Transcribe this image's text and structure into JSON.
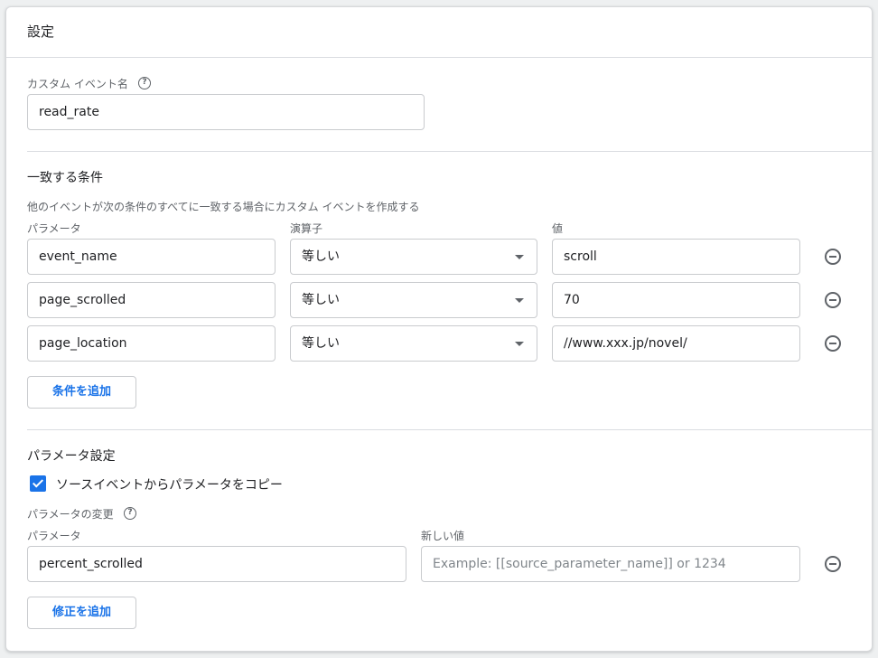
{
  "header": {
    "title": "設定"
  },
  "custom_event": {
    "label": "カスタム イベント名",
    "value": "read_rate"
  },
  "conditions": {
    "title": "一致する条件",
    "description": "他のイベントが次の条件のすべてに一致する場合にカスタム イベントを作成する",
    "columns": {
      "parameter": "パラメータ",
      "operator": "演算子",
      "value": "値"
    },
    "rows": [
      {
        "parameter": "event_name",
        "operator": "等しい",
        "value": "scroll"
      },
      {
        "parameter": "page_scrolled",
        "operator": "等しい",
        "value": "70"
      },
      {
        "parameter": "page_location",
        "operator": "等しい",
        "value": "//www.xxx.jp/novel/"
      }
    ],
    "add_button": "条件を追加"
  },
  "parameter_settings": {
    "title": "パラメータ設定",
    "copy_checkbox": {
      "label": "ソースイベントからパラメータをコピー",
      "checked": true
    },
    "modify_label": "パラメータの変更",
    "columns": {
      "parameter": "パラメータ",
      "new_value": "新しい値"
    },
    "rows": [
      {
        "parameter": "percent_scrolled",
        "new_value": "",
        "placeholder": "Example: [[source_parameter_name]] or 1234"
      }
    ],
    "add_button": "修正を追加"
  },
  "icons": {
    "help": "help-circle-icon",
    "remove": "minus-circle-icon",
    "dropdown": "dropdown-arrow-icon",
    "check": "checkbox-checked-icon"
  },
  "colors": {
    "accent": "#1a73e8"
  }
}
